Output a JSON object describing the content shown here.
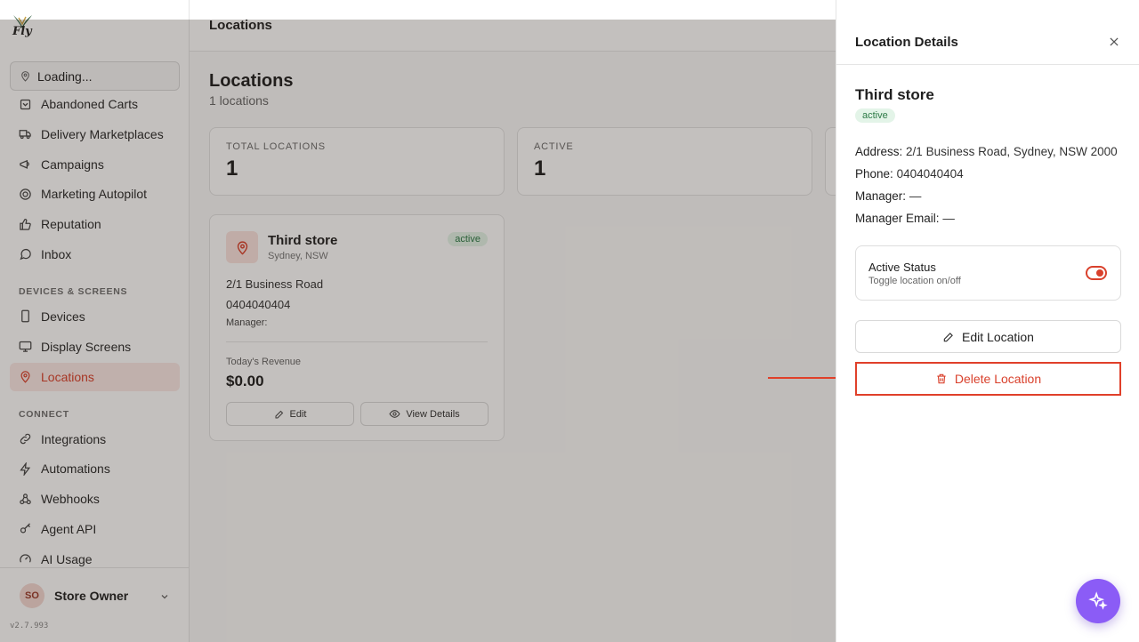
{
  "app": {
    "logo_text": "Fly",
    "version": "v2.7.993"
  },
  "location_selector": {
    "label": "Loading..."
  },
  "sidebar": {
    "items_top": [
      {
        "label": "Abandoned Carts",
        "icon": "cart-icon"
      },
      {
        "label": "Delivery Marketplaces",
        "icon": "truck-icon"
      },
      {
        "label": "Campaigns",
        "icon": "megaphone-icon"
      },
      {
        "label": "Marketing Autopilot",
        "icon": "target-icon"
      },
      {
        "label": "Reputation",
        "icon": "thumbs-up-icon"
      },
      {
        "label": "Inbox",
        "icon": "chat-icon"
      }
    ],
    "section_devices": "DEVICES & SCREENS",
    "items_devices": [
      {
        "label": "Devices",
        "icon": "phone-icon"
      },
      {
        "label": "Display Screens",
        "icon": "monitor-icon"
      },
      {
        "label": "Locations",
        "icon": "map-pin-icon"
      }
    ],
    "section_connect": "CONNECT",
    "items_connect": [
      {
        "label": "Integrations",
        "icon": "link-icon"
      },
      {
        "label": "Automations",
        "icon": "bolt-icon"
      },
      {
        "label": "Webhooks",
        "icon": "webhook-icon"
      },
      {
        "label": "Agent API",
        "icon": "key-icon"
      },
      {
        "label": "AI Usage",
        "icon": "gauge-icon"
      }
    ]
  },
  "user": {
    "initials": "SO",
    "name": "Store Owner"
  },
  "topbar": {
    "title": "Locations"
  },
  "page": {
    "title": "Locations",
    "subtitle": "1 locations",
    "stats": [
      {
        "label": "TOTAL LOCATIONS",
        "value": "1"
      },
      {
        "label": "ACTIVE",
        "value": "1"
      }
    ]
  },
  "location_card": {
    "name": "Third store",
    "city": "Sydney, NSW",
    "status": "active",
    "address": "2/1 Business Road",
    "phone": "0404040404",
    "manager": "Manager:",
    "revenue_label": "Today's Revenue",
    "revenue": "$0.00",
    "edit_label": "Edit",
    "view_label": "View Details"
  },
  "drawer": {
    "title": "Location Details",
    "name": "Third store",
    "status": "active",
    "address_label": "Address:",
    "address": "2/1 Business Road, Sydney, NSW 2000",
    "phone_label": "Phone:",
    "phone": "0404040404",
    "manager_label": "Manager:",
    "manager": "—",
    "manager_email_label": "Manager Email:",
    "manager_email": "—",
    "toggle_title": "Active Status",
    "toggle_sub": "Toggle location on/off",
    "toggle_on": true,
    "edit_label": "Edit Location",
    "delete_label": "Delete Location"
  },
  "colors": {
    "accent": "#d9412c",
    "fab": "#8b5cf6",
    "badge_green": "#2c7a46"
  }
}
